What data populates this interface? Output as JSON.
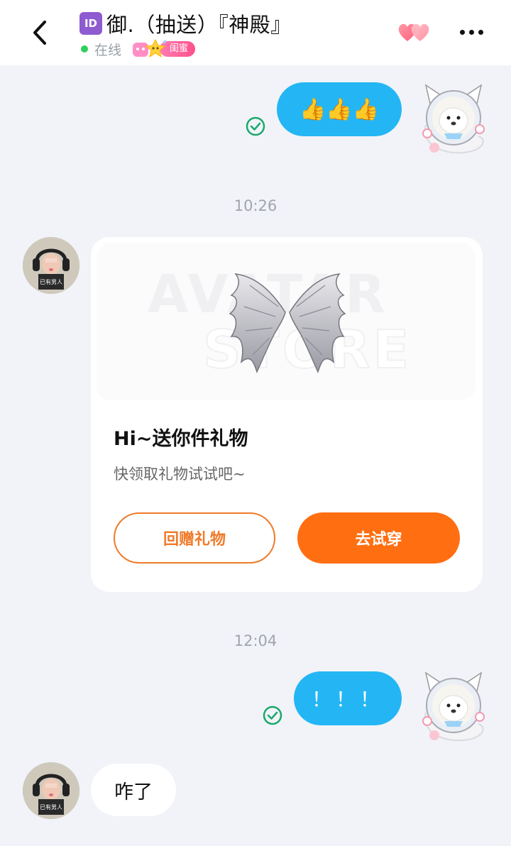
{
  "header": {
    "id_badge": "ID",
    "title": "御.（抽送）『神殿』",
    "status": "在线",
    "relation_tag": "闺蜜",
    "colors": {
      "online": "#2fcf5c",
      "tag": "#ff5b94"
    }
  },
  "messages": [
    {
      "side": "right",
      "type": "text",
      "text": "👍👍👍",
      "status": "sent-check-icon"
    },
    {
      "type": "time",
      "text": "10:26"
    },
    {
      "side": "left",
      "type": "gift-card",
      "watermark_1": "AVATAR",
      "watermark_2": "STORE",
      "title": "Hi~送你件礼物",
      "subtitle": "快领取礼物试试吧~",
      "button_return": "回赠礼物",
      "button_try": "去试穿",
      "colors": {
        "accent": "#ff6f12"
      }
    },
    {
      "type": "time",
      "text": "12:04"
    },
    {
      "side": "right",
      "type": "text",
      "text": "！！！",
      "status": "sent-check-icon"
    },
    {
      "side": "left",
      "type": "text",
      "text": "咋了"
    }
  ],
  "avatar_left": {
    "caption": "已有男人"
  },
  "colors": {
    "bubble_right": "#24b6f4",
    "background": "#f1f3f8"
  }
}
